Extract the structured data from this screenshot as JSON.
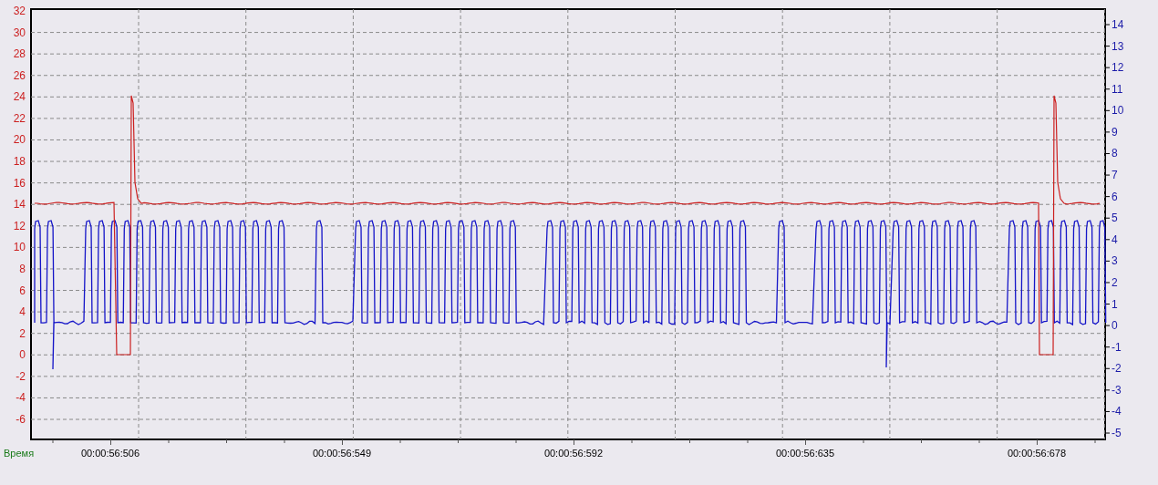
{
  "chart": {
    "left_axis": {
      "ticks": [
        "32",
        "30",
        "28",
        "26",
        "24",
        "22",
        "20",
        "18",
        "16",
        "14",
        "12",
        "10",
        "8",
        "6",
        "4",
        "2",
        "0",
        "-2",
        "-4",
        "-6"
      ]
    },
    "right_axis": {
      "ticks": [
        "14",
        "13",
        "12",
        "11",
        "10",
        "9",
        "8",
        "7",
        "6",
        "5",
        "4",
        "3",
        "2",
        "1",
        "0",
        "-1",
        "-2",
        "-3",
        "-4",
        "-5"
      ]
    },
    "time_axis": {
      "label": "Время",
      "ticks": [
        "00:00:56:506",
        "00:00:56:549",
        "00:00:56:592",
        "00:00:56:635",
        "00:00:56:678"
      ]
    }
  }
}
